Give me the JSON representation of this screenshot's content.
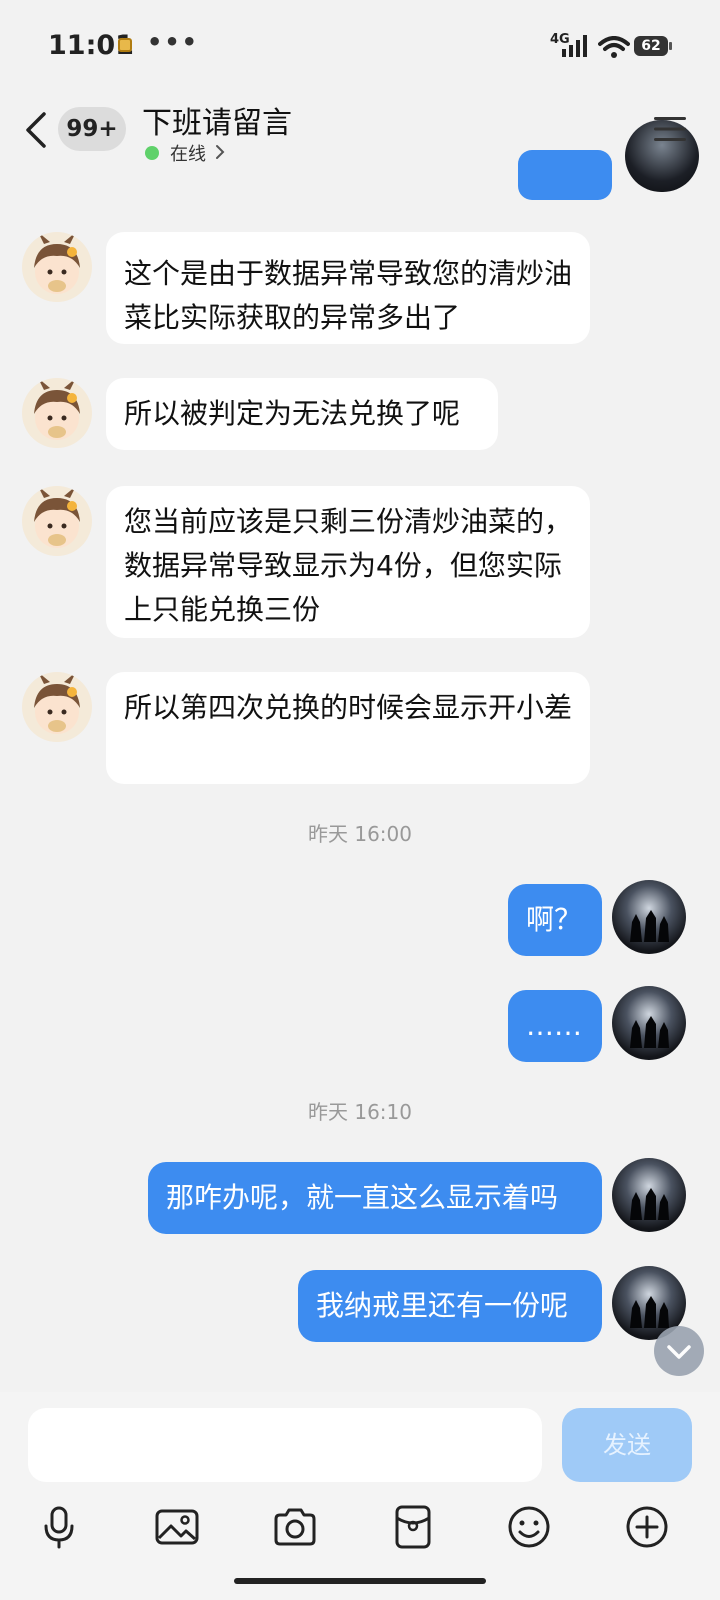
{
  "status_bar": {
    "time": "11:01",
    "dots": "•••",
    "network": "4G",
    "battery": "62"
  },
  "header": {
    "back_count": "99+",
    "title": "下班请留言",
    "status": "在线"
  },
  "messages": [
    {
      "side": "left",
      "text": "这个是由于数据异常导致您的清炒油菜比实际获取的异常多出了"
    },
    {
      "side": "left",
      "text": "所以被判定为无法兑换了呢"
    },
    {
      "side": "left",
      "text": "您当前应该是只剩三份清炒油菜的，数据异常导致显示为4份，但您实际上只能兑换三份"
    },
    {
      "side": "left",
      "text": "所以第四次兑换的时候会显示开小差"
    },
    {
      "side": "time",
      "text": "昨天 16:00"
    },
    {
      "side": "right",
      "text": "啊？"
    },
    {
      "side": "right",
      "text": "……"
    },
    {
      "side": "time",
      "text": "昨天 16:10"
    },
    {
      "side": "right",
      "text": "那咋办呢，就一直这么显示着吗"
    },
    {
      "side": "right",
      "text": "我纳戒里还有一份呢"
    }
  ],
  "input": {
    "value": "",
    "send_label": "发送"
  },
  "toolbar": [
    "microphone-icon",
    "image-icon",
    "camera-icon",
    "red-packet-icon",
    "emoji-icon",
    "plus-icon"
  ],
  "colors": {
    "bubble_right": "#3d8cf0",
    "bubble_left": "#ffffff",
    "background": "#f2f2f2",
    "online": "#5fd16a"
  }
}
